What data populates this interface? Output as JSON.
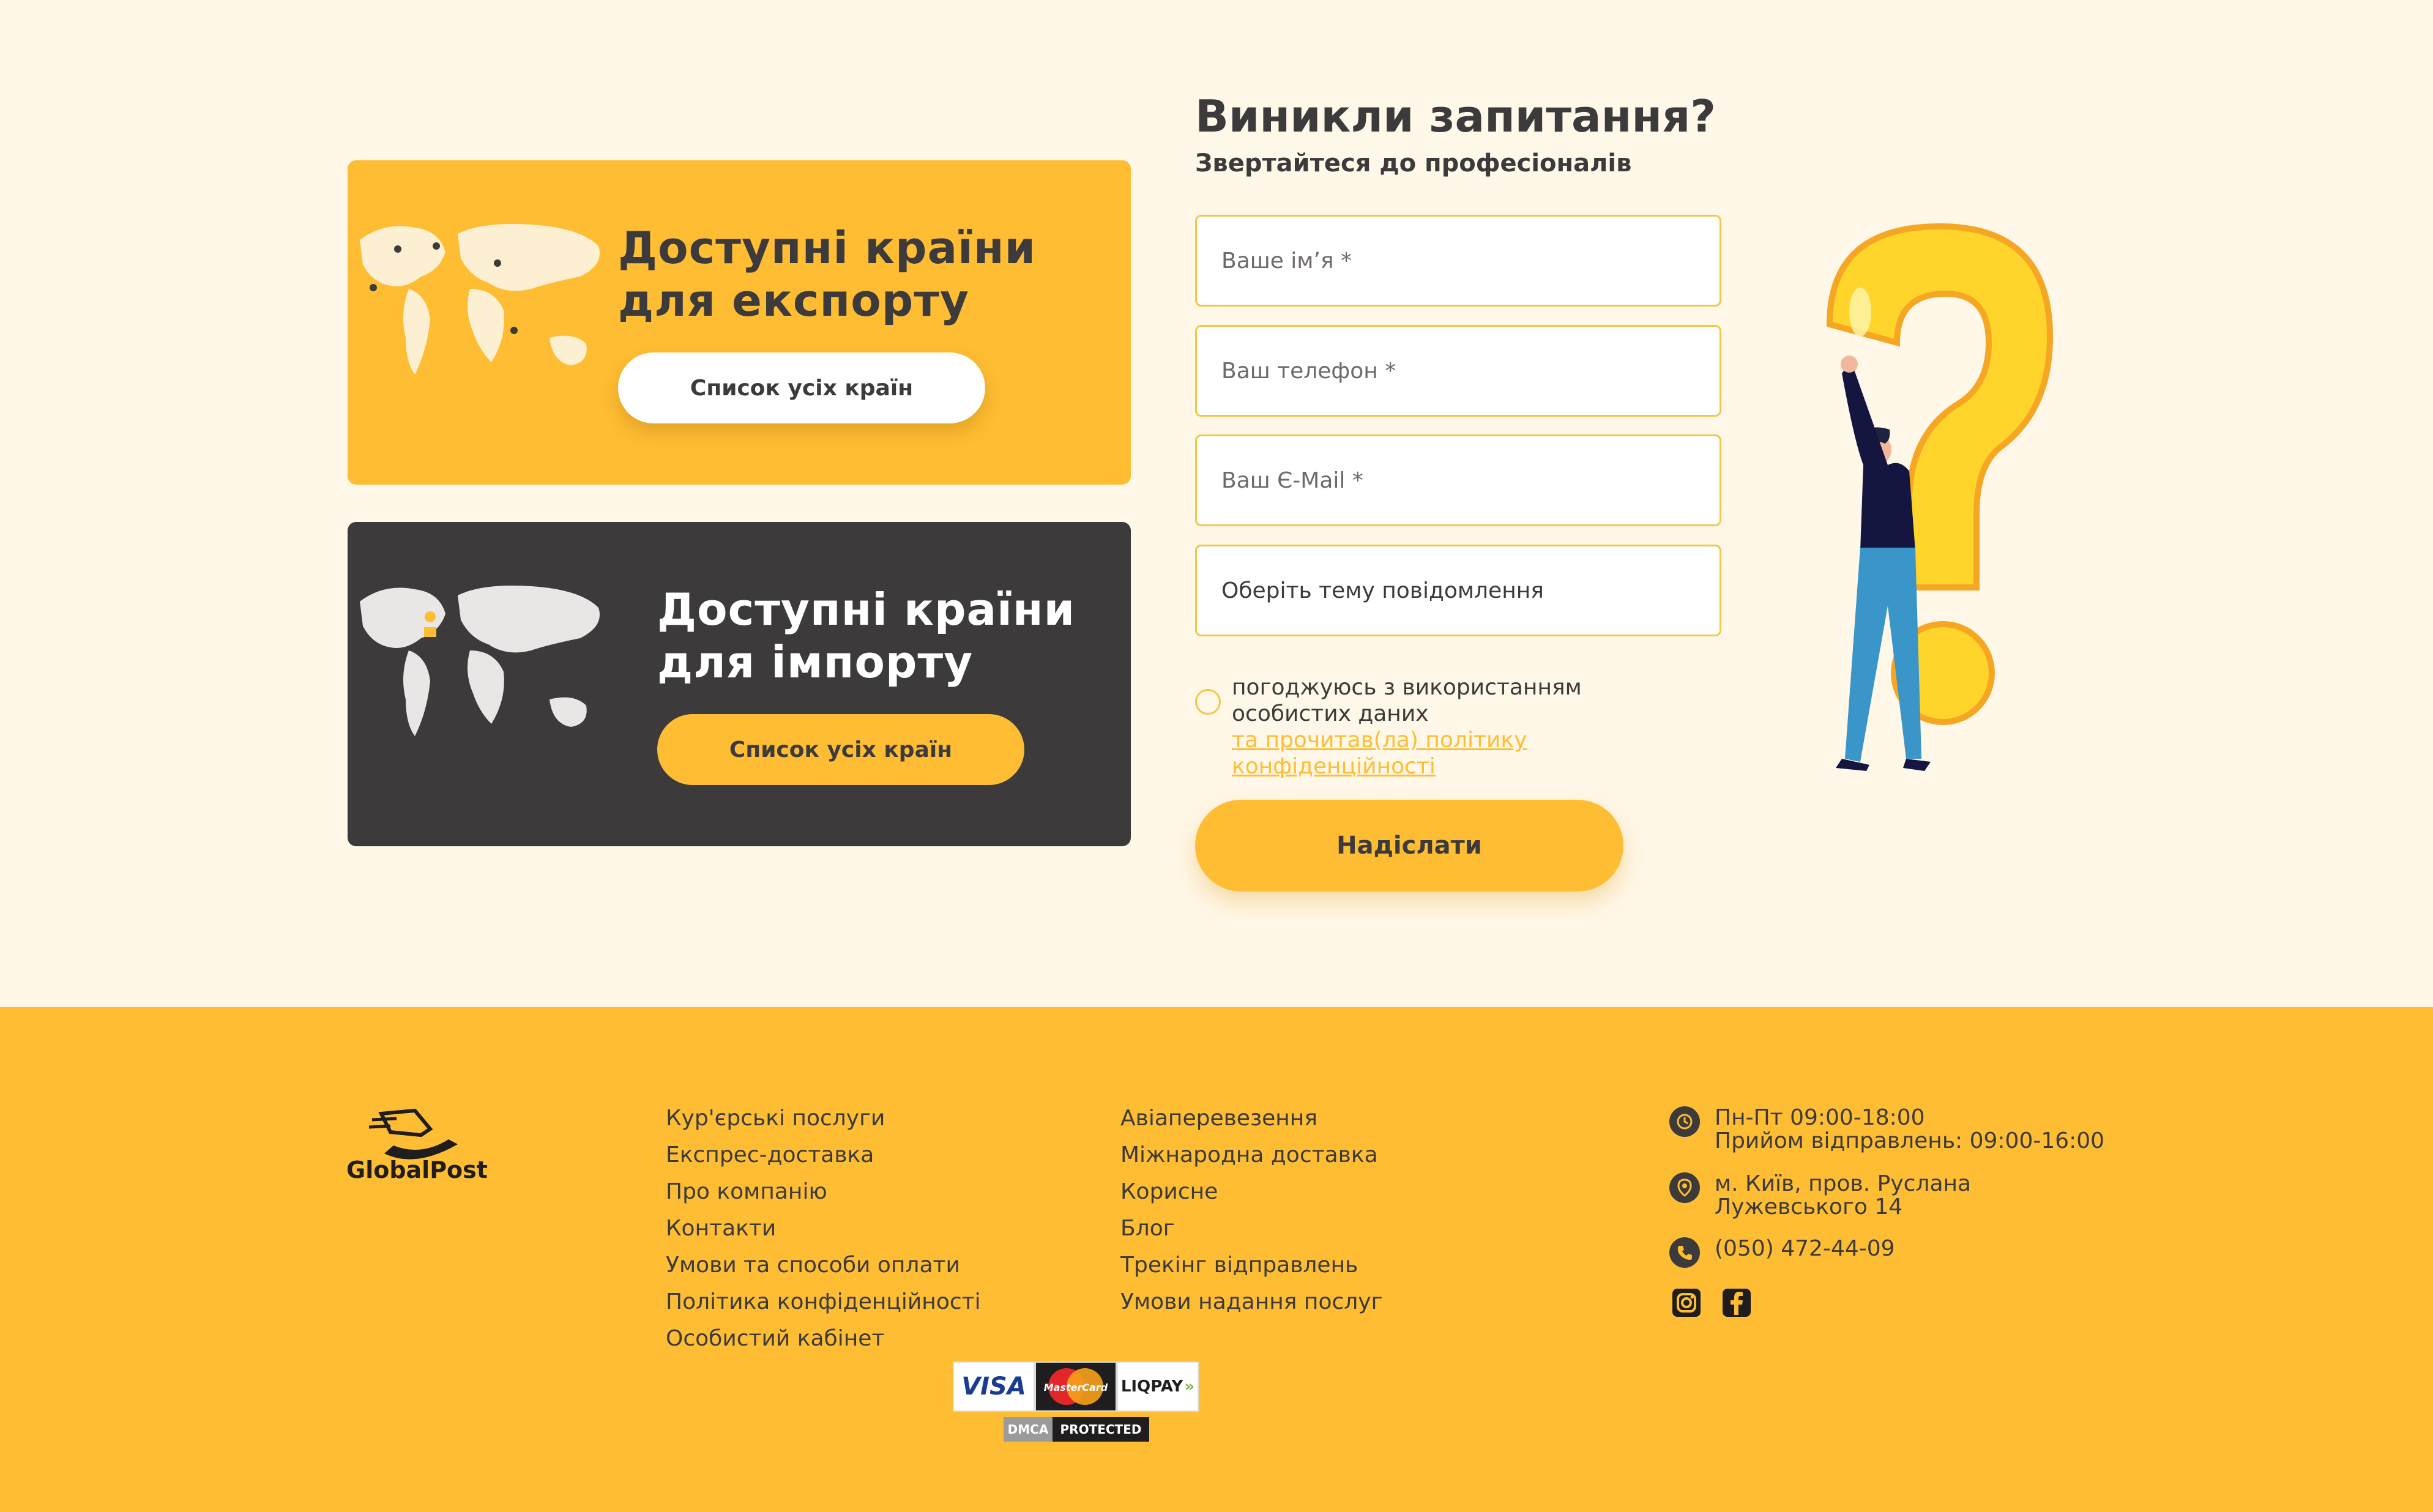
{
  "export_card": {
    "title_line1": "Доступні країни",
    "title_line2": "для експорту",
    "button_label": "Список усіх країн"
  },
  "import_card": {
    "title_line1": "Доступні країни",
    "title_line2": "для імпорту",
    "button_label": "Список усіх країн"
  },
  "form": {
    "title": "Виникли запитання?",
    "subtitle": "Звертайтеся до професіоналів",
    "name_placeholder": "Ваше ім’я *",
    "phone_placeholder": "Ваш телефон *",
    "email_placeholder": "Ваш Є-Mail *",
    "topic_select": "Оберіть тему повідомлення",
    "consent_line1": "погоджуюсь з використанням",
    "consent_line2": "особистих даних",
    "consent_link_line1": "та прочитав(ла) політику",
    "consent_link_line2": "конфіденційності",
    "submit_label": "Надіслати"
  },
  "footer": {
    "logo_text": "GlobalPost",
    "col1": [
      "Кур'єрські послуги",
      "Експрес-доставка",
      "Про компанію",
      "Контакти",
      "Умови та способи оплати",
      "Політика конфіденційності",
      "Особистий кабінет"
    ],
    "col2": [
      "Авіаперевезення",
      "Міжнародна доставка",
      "Корисне",
      "Блог",
      "Трекінг відправлень",
      "Умови надання послуг"
    ],
    "hours_line1": "Пн-Пт 09:00-18:00",
    "hours_line2": "Прийом відправлень: 09:00-16:00",
    "address_line1": "м. Київ, пров. Руслана",
    "address_line2": "Лужевського 14",
    "phone": "(050) 472-44-09",
    "payments": {
      "visa": "VISA",
      "mastercard": "MasterCard",
      "liqpay": "LIQPAY",
      "dmca_left": "DMCA",
      "dmca_right": "PROTECTED"
    },
    "icons": [
      "clock-icon",
      "location-pin-icon",
      "phone-icon",
      "instagram-icon",
      "facebook-icon"
    ]
  },
  "colors": {
    "accent_yellow": "#ffbd33",
    "dark": "#3c3a3b",
    "background": "#fff7e8"
  }
}
